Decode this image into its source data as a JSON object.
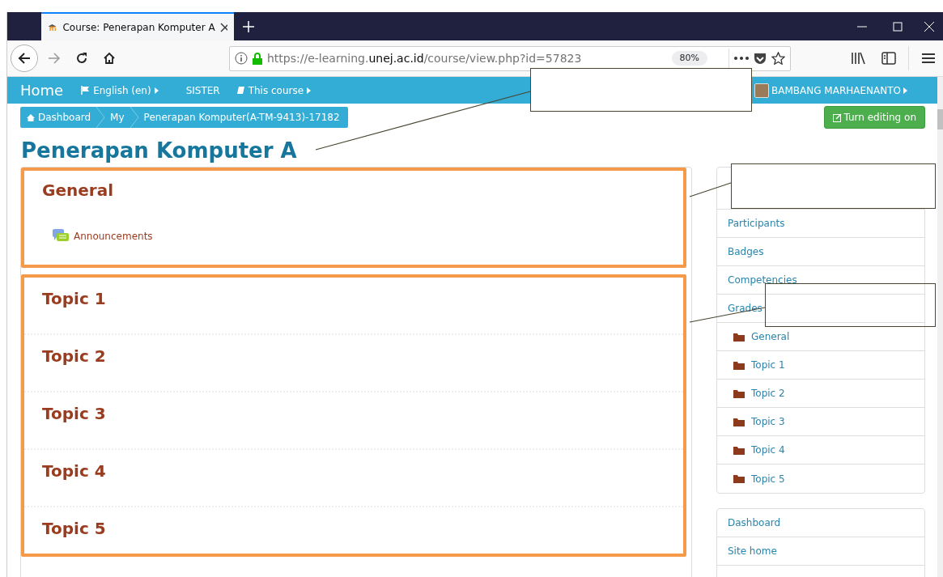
{
  "browser": {
    "tab_title": "Course: Penerapan Komputer A",
    "url_prefix": "https://e-learning.",
    "url_domain": "unej.ac.id",
    "url_suffix": "/course/view.php?id=57823",
    "zoom": "80%"
  },
  "navbar": {
    "brand": "Home",
    "items": [
      {
        "label": "English (en)",
        "kind": "flag",
        "dropdown": true
      },
      {
        "label": "SISTER",
        "kind": "plain",
        "dropdown": false
      },
      {
        "label": "This course",
        "kind": "book",
        "dropdown": true
      }
    ],
    "user": "BAMBANG MARHAENANTO"
  },
  "breadcrumb": [
    "Dashboard",
    "My",
    "Penerapan Komputer(A-TM-9413)-17182"
  ],
  "edit_button": "Turn editing on",
  "course_title": "Penerapan Komputer A",
  "sections": [
    {
      "title": "General",
      "activities": [
        {
          "name": "Announcements"
        }
      ]
    },
    {
      "title": "Topic 1"
    },
    {
      "title": "Topic 2"
    },
    {
      "title": "Topic 3"
    },
    {
      "title": "Topic 4"
    },
    {
      "title": "Topic 5"
    }
  ],
  "sidebar": {
    "blocks": [
      {
        "items": [
          {
            "kind": "covered"
          },
          {
            "kind": "link",
            "label": "Participants"
          },
          {
            "kind": "link",
            "label": "Badges"
          },
          {
            "kind": "link",
            "label": "Competencies"
          },
          {
            "kind": "link",
            "label": "Grades"
          },
          {
            "kind": "folder",
            "label": "General"
          },
          {
            "kind": "folder",
            "label": "Topic 1"
          },
          {
            "kind": "folder",
            "label": "Topic 2"
          },
          {
            "kind": "folder",
            "label": "Topic 3"
          },
          {
            "kind": "folder",
            "label": "Topic 4"
          },
          {
            "kind": "folder",
            "label": "Topic 5"
          }
        ]
      },
      {
        "items": [
          {
            "kind": "link",
            "label": "Dashboard"
          },
          {
            "kind": "link",
            "label": "Site home"
          },
          {
            "kind": "covered"
          }
        ]
      }
    ]
  }
}
